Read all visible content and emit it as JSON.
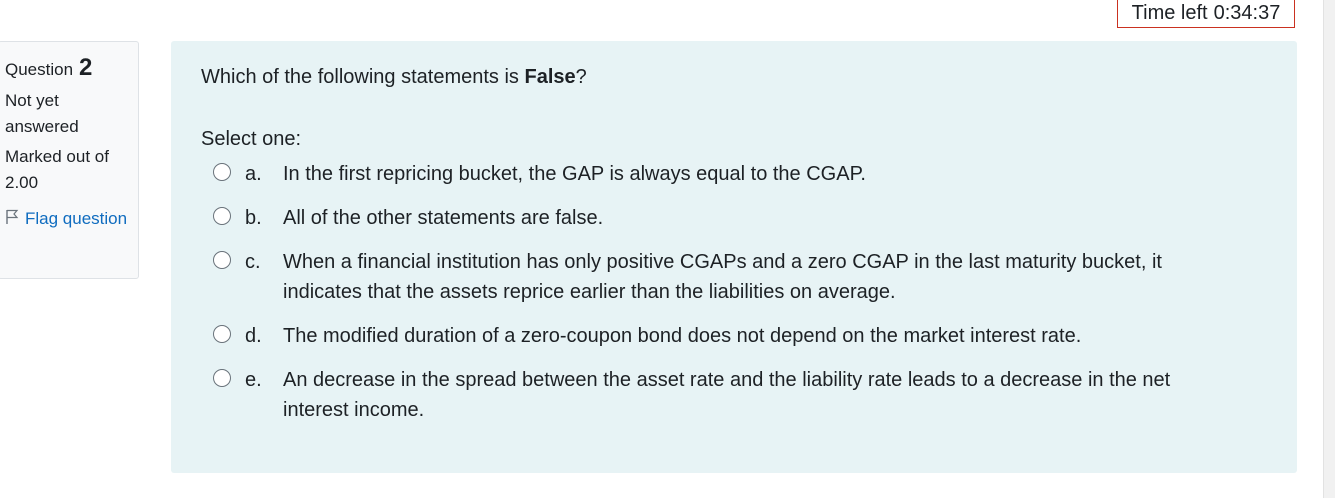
{
  "timer": {
    "label": "Time left",
    "value": "0:34:37"
  },
  "info": {
    "question_label": "Question",
    "question_number": "2",
    "state": "Not yet answered",
    "grade": "Marked out of 2.00",
    "flag_label": "Flag question"
  },
  "question": {
    "text_before": "Which of the following statements is ",
    "text_bold": "False",
    "text_after": "?",
    "prompt": "Select one:",
    "options": [
      {
        "letter": "a.",
        "text": "In the first repricing bucket, the GAP is always equal to the CGAP."
      },
      {
        "letter": "b.",
        "text": "All of the other statements are false."
      },
      {
        "letter": "c.",
        "text": "When a financial institution has only positive CGAPs and a zero CGAP in the last maturity bucket, it indicates that the assets reprice earlier than the liabilities on average."
      },
      {
        "letter": "d.",
        "text": "The modified duration of a zero-coupon bond does not depend on the market interest rate."
      },
      {
        "letter": "e.",
        "text": "An decrease in the spread between the asset rate and the liability rate leads to a decrease in the net interest income."
      }
    ]
  },
  "colors": {
    "content_background": "#e7f3f5",
    "info_background": "#f8f9fa",
    "link": "#0f6cbf",
    "timer_border": "#ca3120"
  }
}
